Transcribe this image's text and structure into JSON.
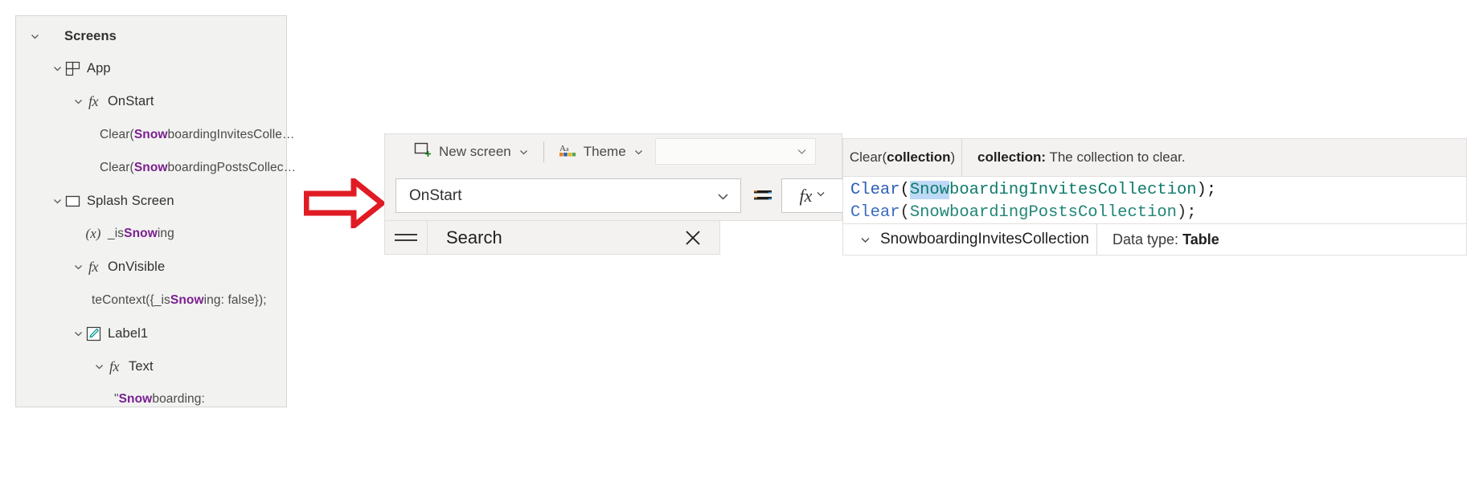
{
  "tree": {
    "panel_name": "screens-tree-panel",
    "items": [
      {
        "label": "Screens",
        "bold": true,
        "indent": 14,
        "chevron": true,
        "icon": "none"
      },
      {
        "label": "App",
        "bold": false,
        "indent": 42,
        "chevron": true,
        "icon": "app-grid-icon"
      },
      {
        "label": "OnStart",
        "bold": false,
        "indent": 68,
        "chevron": true,
        "icon": "fx-icon"
      },
      {
        "label": "Clear(SnowboardingInvitesColle...",
        "highlight": "Snow",
        "code": true,
        "indent": 104,
        "chevron": false,
        "icon": "none"
      },
      {
        "label": "Clear(SnowboardingPostsCollec...",
        "highlight": "Snow",
        "code": true,
        "indent": 104,
        "chevron": false,
        "icon": "none"
      },
      {
        "label": "Splash Screen",
        "bold": false,
        "indent": 42,
        "chevron": true,
        "icon": "screen-icon"
      },
      {
        "label": "_isSnowing",
        "highlight": "Snow",
        "indent": 68,
        "chevron": false,
        "icon": "variable-x-icon"
      },
      {
        "label": "OnVisible",
        "bold": false,
        "indent": 68,
        "chevron": true,
        "icon": "fx-icon"
      },
      {
        "label": "teContext({_isSnowing: false});",
        "highlight": "Snow",
        "code": true,
        "indent": 94,
        "chevron": false,
        "icon": "none"
      },
      {
        "label": "Label1",
        "bold": false,
        "indent": 68,
        "chevron": true,
        "icon": "label-pencil-icon"
      },
      {
        "label": "Text",
        "bold": false,
        "indent": 94,
        "chevron": true,
        "icon": "fx-icon"
      },
      {
        "label": "\"Snowboarding:",
        "highlight": "Snow",
        "code": true,
        "indent": 122,
        "chevron": false,
        "icon": "none"
      }
    ]
  },
  "arrow": {
    "name": "red-arrow-annotation",
    "color": "#e01b24"
  },
  "command_bar": {
    "new_screen_label": "New screen",
    "theme_label": "Theme",
    "combo_value": ""
  },
  "formula_bar": {
    "property_value": "OnStart",
    "equals_label": "=",
    "fx_label": "fx"
  },
  "search_strip": {
    "search_label": "Search",
    "close_label": "✕"
  },
  "intellisense": {
    "signature_prefix": "Clear(",
    "signature_param": "collection",
    "signature_suffix": ")",
    "description_param": "collection:",
    "description_text": "The collection to clear.",
    "code_line_1_fn": "Clear",
    "code_line_1_sel": "Snow",
    "code_line_1_rest": "boardingInvitesCollection",
    "code_line_1_tail": ");",
    "code_line_2_fn": "Clear",
    "code_line_2_id": "SnowboardingPostsCollection",
    "code_line_2_tail": ");",
    "suggestion_name": "SnowboardingInvitesCollection",
    "data_type_label": "Data type:",
    "data_type_value": "Table"
  },
  "colors": {
    "panel_bg": "#f2f2f1",
    "accent_purple": "#7a1f8f",
    "selection_blue": "#bdd9f7",
    "code_teal": "#0f7b6c",
    "code_blue": "#2b5fb8",
    "arrow_red": "#e01b24"
  }
}
